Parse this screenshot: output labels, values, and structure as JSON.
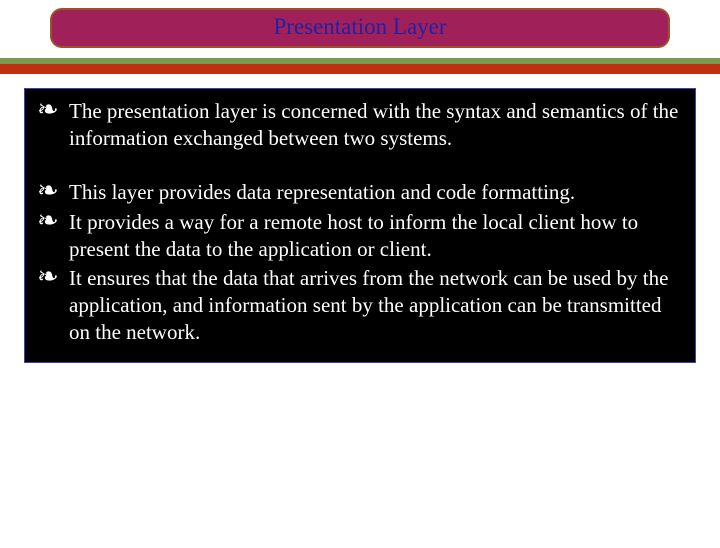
{
  "title": "Presentation Layer",
  "bullets": {
    "b1": "The presentation layer is concerned with the syntax and semantics of the information exchanged between two systems.",
    "b2": "This layer provides data representation and code formatting.",
    "b3": "It provides a way for a remote host to inform the local client how to present the data to the application or client.",
    "b4": "It ensures that the data that arrives from the network can be used by the application, and information sent by the application can be transmitted on the network."
  }
}
